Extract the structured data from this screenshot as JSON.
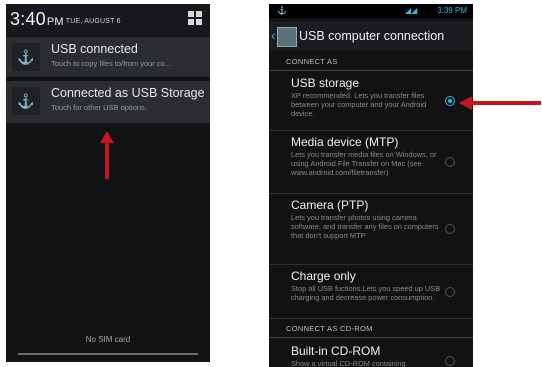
{
  "left_screen": {
    "clock": {
      "time": "3:40",
      "ampm": "PM",
      "date": "TUE, AUGUST 6"
    },
    "quick_settings_icon": "grid-icon",
    "notifications": [
      {
        "icon": "usb-icon",
        "title": "USB connected",
        "subtitle": "Touch to copy files to/from your co..."
      },
      {
        "icon": "usb-icon",
        "title": "Connected as USB Storage",
        "subtitle": "Touch for other USB options."
      }
    ],
    "status_text": "No SIM card"
  },
  "right_screen": {
    "status_bar": {
      "time": "3:39",
      "ampm": "PM"
    },
    "title": "USB computer connection",
    "section_connect_as": "CONNECT AS",
    "options": [
      {
        "title": "USB storage",
        "description": "XP recommended. Lets you transfer files between your computer and your Android device.",
        "selected": true
      },
      {
        "title": "Media device (MTP)",
        "description": "Lets you transfer media files on Windows, or using Android File Transfer on Mac (see www.android.com/filetransfer)",
        "selected": false
      },
      {
        "title": "Camera (PTP)",
        "description": "Lets you transfer photos using camera software, and transfer any files on computers that don't support MTP",
        "selected": false
      },
      {
        "title": "Charge only",
        "description": "Stop all USB fuctions.Lets you speed up USB charging and decrease power consumption.",
        "selected": false
      }
    ],
    "section_cdrom": "CONNECT AS CD-ROM",
    "cdrom_option": {
      "title": "Built-in CD-ROM",
      "description": "Show a virtual CD-ROM containing",
      "selected": false
    }
  },
  "colors": {
    "accent": "#33b5e5",
    "annotation_arrow": "#c8161d",
    "background": "#111214"
  }
}
